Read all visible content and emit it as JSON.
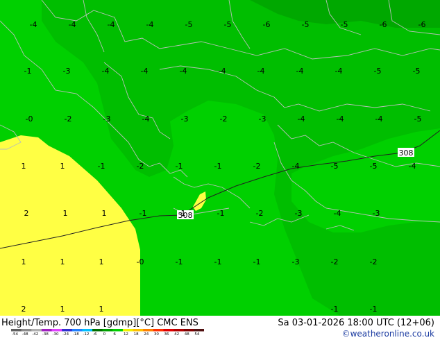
{
  "title_left": "Height/Temp. 700 hPa [gdmp][°C] CMC ENS",
  "title_right": "Sa 03-01-2026 18:00 UTC (12+06)",
  "credit": "©weatheronline.co.uk",
  "contour_label": "308",
  "legend": {
    "ticks": [
      "-54",
      "-48",
      "-42",
      "-38",
      "-30",
      "-24",
      "-18",
      "-12",
      "-6",
      "0",
      "6",
      "12",
      "18",
      "24",
      "30",
      "36",
      "42",
      "48",
      "54"
    ],
    "colors": [
      "#606060",
      "#8c8c8c",
      "#b0b0b0",
      "#a020c0",
      "#e040ff",
      "#3030d0",
      "#2080ff",
      "#00c0ff",
      "#007000",
      "#00a000",
      "#00d000",
      "#f0f000",
      "#ffc000",
      "#ff8000",
      "#ff3000",
      "#e00000",
      "#b00000",
      "#800000",
      "#501010"
    ]
  },
  "temperature_labels": [
    {
      "text": "-4",
      "row": 0,
      "col": 0
    },
    {
      "text": "-4",
      "row": 0,
      "col": 1
    },
    {
      "text": "-4",
      "row": 0,
      "col": 2
    },
    {
      "text": "-4",
      "row": 0,
      "col": 3
    },
    {
      "text": "-5",
      "row": 0,
      "col": 4
    },
    {
      "text": "-5",
      "row": 0,
      "col": 5
    },
    {
      "text": "-6",
      "row": 0,
      "col": 6
    },
    {
      "text": "-5",
      "row": 0,
      "col": 7
    },
    {
      "text": "-5",
      "row": 0,
      "col": 8
    },
    {
      "text": "-6",
      "row": 0,
      "col": 9
    },
    {
      "text": "-6",
      "row": 0,
      "col": 10
    },
    {
      "text": "-1",
      "row": 1,
      "col": 0
    },
    {
      "text": "-3",
      "row": 1,
      "col": 1
    },
    {
      "text": "-4",
      "row": 1,
      "col": 2
    },
    {
      "text": "-4",
      "row": 1,
      "col": 3
    },
    {
      "text": "-4",
      "row": 1,
      "col": 4
    },
    {
      "text": "-4",
      "row": 1,
      "col": 5
    },
    {
      "text": "-4",
      "row": 1,
      "col": 6
    },
    {
      "text": "-4",
      "row": 1,
      "col": 7
    },
    {
      "text": "-4",
      "row": 1,
      "col": 8
    },
    {
      "text": "-5",
      "row": 1,
      "col": 9
    },
    {
      "text": "-5",
      "row": 1,
      "col": 10
    },
    {
      "text": "-0",
      "row": 2,
      "col": 0
    },
    {
      "text": "-2",
      "row": 2,
      "col": 1
    },
    {
      "text": "-3",
      "row": 2,
      "col": 2
    },
    {
      "text": "-4",
      "row": 2,
      "col": 3
    },
    {
      "text": "-3",
      "row": 2,
      "col": 4
    },
    {
      "text": "-2",
      "row": 2,
      "col": 5
    },
    {
      "text": "-3",
      "row": 2,
      "col": 6
    },
    {
      "text": "-4",
      "row": 2,
      "col": 7
    },
    {
      "text": "-4",
      "row": 2,
      "col": 8
    },
    {
      "text": "-4",
      "row": 2,
      "col": 9
    },
    {
      "text": "-5",
      "row": 2,
      "col": 10
    },
    {
      "text": "1",
      "row": 3,
      "col": 0
    },
    {
      "text": "1",
      "row": 3,
      "col": 1
    },
    {
      "text": "-1",
      "row": 3,
      "col": 2
    },
    {
      "text": "-2",
      "row": 3,
      "col": 3
    },
    {
      "text": "-1",
      "row": 3,
      "col": 4
    },
    {
      "text": "-1",
      "row": 3,
      "col": 5
    },
    {
      "text": "-2",
      "row": 3,
      "col": 6
    },
    {
      "text": "-4",
      "row": 3,
      "col": 7
    },
    {
      "text": "-5",
      "row": 3,
      "col": 8
    },
    {
      "text": "-5",
      "row": 3,
      "col": 9
    },
    {
      "text": "-4",
      "row": 3,
      "col": 10
    },
    {
      "text": "2",
      "row": 4,
      "col": 0
    },
    {
      "text": "1",
      "row": 4,
      "col": 1
    },
    {
      "text": "1",
      "row": 4,
      "col": 2
    },
    {
      "text": "-1",
      "row": 4,
      "col": 3
    },
    {
      "text": "-1",
      "row": 4,
      "col": 4
    },
    {
      "text": "-1",
      "row": 4,
      "col": 5
    },
    {
      "text": "-2",
      "row": 4,
      "col": 6
    },
    {
      "text": "-3",
      "row": 4,
      "col": 7
    },
    {
      "text": "-4",
      "row": 4,
      "col": 8
    },
    {
      "text": "-3",
      "row": 4,
      "col": 9
    },
    {
      "text": "1",
      "row": 5,
      "col": 0
    },
    {
      "text": "1",
      "row": 5,
      "col": 1
    },
    {
      "text": "1",
      "row": 5,
      "col": 2
    },
    {
      "text": "-0",
      "row": 5,
      "col": 3
    },
    {
      "text": "-1",
      "row": 5,
      "col": 4
    },
    {
      "text": "-1",
      "row": 5,
      "col": 5
    },
    {
      "text": "-1",
      "row": 5,
      "col": 6
    },
    {
      "text": "-3",
      "row": 5,
      "col": 7
    },
    {
      "text": "-2",
      "row": 5,
      "col": 8
    },
    {
      "text": "-2",
      "row": 5,
      "col": 9
    },
    {
      "text": "2",
      "row": 6,
      "col": 0
    },
    {
      "text": "1",
      "row": 6,
      "col": 1
    },
    {
      "text": "1",
      "row": 6,
      "col": 2
    },
    {
      "text": "-1",
      "row": 6,
      "col": 8
    },
    {
      "text": "-1",
      "row": 6,
      "col": 9
    }
  ]
}
